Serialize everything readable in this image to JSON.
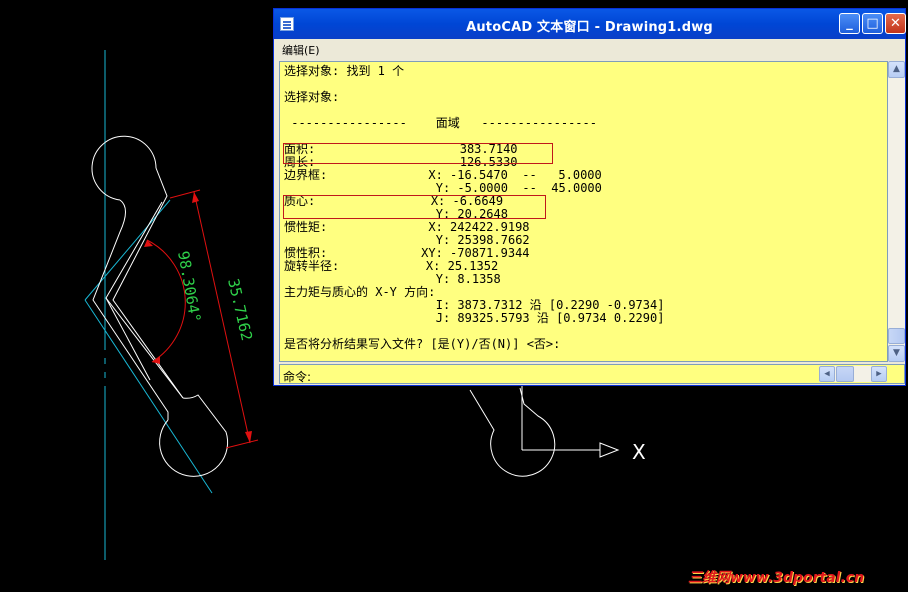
{
  "window": {
    "title": "AutoCAD 文本窗口 - Drawing1.dwg",
    "min_glyph": "_",
    "max_glyph": "□",
    "close_glyph": "✕"
  },
  "menubar": {
    "edit_label": "编辑(E)"
  },
  "text_lines": [
    "选择对象: 找到 1 个",
    "",
    "选择对象:",
    "",
    " ----------------    面域   ----------------",
    "",
    "面积:                    383.7140",
    "周长:                    126.5330",
    "边界框:              X: -16.5470  --   5.0000",
    "                     Y: -5.0000  --  45.0000",
    "质心:                X: -6.6649",
    "                     Y: 20.2648",
    "惯性矩:              X: 242422.9198",
    "                     Y: 25398.7662",
    "惯性积:             XY: -70871.9344",
    "旋转半径:            X: 25.1352",
    "                     Y: 8.1358",
    "主力矩与质心的 X-Y 方向:",
    "                     I: 3873.7312 沿 [0.2290 -0.9734]",
    "                     J: 89325.5793 沿 [0.9734 0.2290]",
    "",
    "是否将分析结果写入文件? [是(Y)/否(N)] <否>:"
  ],
  "command": {
    "label": "命令:"
  },
  "drawing": {
    "dim_angle": "98.3064°",
    "dim_length": "35.7162",
    "axis_label": "X",
    "angle_color": "#2fd14a",
    "dim_color": "#e01010",
    "center_line_color": "#19b7d4"
  },
  "watermark": "三维网www.3dportal.cn",
  "colors": {
    "text_bg": "#ffff80",
    "title_bar": "#0a58e6",
    "highlight_box": "#c0181b"
  }
}
